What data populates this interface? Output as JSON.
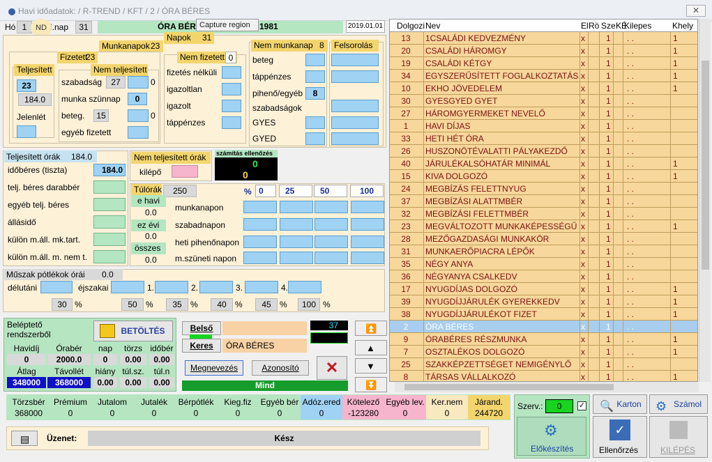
{
  "window": {
    "title": "Havi időadatok: / R-TREND / KFT / 2 / ÓRA BÉRES",
    "close": "✕"
  },
  "tooltip": "Capture region",
  "nd": "ND",
  "header": {
    "ho_label": "Hó",
    "ho_value": "1",
    "mnap_label": "i.nap",
    "mnap_value": "31",
    "title": "ÓRA BÉRE",
    "year_suffix": "1981",
    "date": "2019.01.01"
  },
  "munkanapok": {
    "label": "Munkanapok",
    "value": "23"
  },
  "napok": {
    "label": "Napok",
    "value": "31"
  },
  "fizetett": {
    "label": "Fizetett",
    "value": "23"
  },
  "teljesitett": {
    "label": "Teljesített",
    "value": "23",
    "sub": "184.0",
    "jelenlet": "Jelenlét"
  },
  "nem_teljesitett": {
    "label": "Nem teljesített",
    "rows": [
      {
        "label": "szabadság",
        "value": "27",
        "box": "0"
      },
      {
        "label": "munka szünnap",
        "box": "0"
      },
      {
        "label": "beteg.",
        "value": "15",
        "box": "0"
      },
      {
        "label": "egyéb fizetett"
      }
    ]
  },
  "nem_fizetett": {
    "label": "Nem fizetett",
    "value": "0",
    "rows": [
      "fizetés nélküli",
      "igazoltlan",
      "igazolt",
      "táppénzes"
    ]
  },
  "nem_munkanap": {
    "label": "Nem munkanap",
    "value": "8",
    "rows": [
      {
        "label": "beteg"
      },
      {
        "label": "táppénzes"
      },
      {
        "label": "pihenő/egyéb",
        "value": "8"
      },
      {
        "label": "szabadságok"
      },
      {
        "label": "GYES"
      },
      {
        "label": "GYED"
      }
    ]
  },
  "felsorolas": "Felsorolás",
  "teljesitett_orak": {
    "label": "Teljesített órák",
    "value": "184.0",
    "rows": [
      {
        "label": "időbéres (tiszta)",
        "value": "184.0"
      },
      {
        "label": "telj. béres darabbér"
      },
      {
        "label": "egyéb telj. béres"
      },
      {
        "label": "állásidő"
      },
      {
        "label": "külön m.áll. mk.tart."
      },
      {
        "label": "külön m.áll. m. nem t."
      }
    ]
  },
  "nem_telj_orak": {
    "label": "Nem teljesített órák",
    "kilepo": "kilépő"
  },
  "szamitas": {
    "label": "számítás ellenőzés",
    "v1": "0",
    "v2": "0"
  },
  "tulorak": {
    "label": "Túlórák",
    "value": "250",
    "e_havi": "e havi",
    "e_havi_v": "0.0",
    "ez_evi": "ez évi",
    "ez_evi_v": "0.0",
    "osszes": "összes",
    "osszes_v": "0.0",
    "pct": "%",
    "cols": [
      "0",
      "25",
      "50",
      "100"
    ],
    "rows": [
      "munkanapon",
      "szabadnapon",
      "heti pihenőnapon",
      "m.szüneti napon"
    ]
  },
  "muszak": {
    "label": "Műszak pótlékok órái",
    "value": "0.0",
    "delutani": "délutáni",
    "ejszakai": "éjszakai",
    "n1": "1.",
    "n2": "2.",
    "n3": "3.",
    "n4": "4.",
    "pcts": [
      "30",
      "50",
      "35",
      "40",
      "45",
      "100"
    ],
    "pct": "%"
  },
  "belepteto": {
    "label": "Beléptető rendszerből",
    "button": "BETÖLTÉS",
    "h1": [
      "Havidíj",
      "Órabér",
      "nap",
      "törzs",
      "időbér"
    ],
    "v1": [
      "0",
      "2000.0",
      "0",
      "0.00",
      "0.00"
    ],
    "h2": [
      "Átlag",
      "Távollét",
      "hiány",
      "túl.sz.",
      "túl.n"
    ],
    "v2": [
      "348000",
      "368000",
      "0.00",
      "0.00",
      "0.00"
    ]
  },
  "search": {
    "belso": "Belső",
    "keres": "Keres",
    "keres_value": "ÓRA BÉRES",
    "num": "37",
    "megnevezes": "Megnevezés",
    "azonosito": "Azonosító",
    "mind": "Mind"
  },
  "grid": {
    "headers": [
      "Dolgozi",
      "Nev",
      "El",
      "Rö",
      "Sze",
      "KÉ",
      "Kilepes",
      "Khely"
    ],
    "rows": [
      [
        "13",
        "1CSALÁDI  KEDVEZMÉNY",
        "x",
        "1",
        "1"
      ],
      [
        "20",
        "CSALÁDI HÁROMGY",
        "x",
        "1",
        "1"
      ],
      [
        "19",
        "CSALÁDI KÉTGY",
        "x",
        "1",
        "1"
      ],
      [
        "34",
        "EGYSZERŰSÍTETT FOGLALKOZTATÁS",
        "x",
        "1",
        "1"
      ],
      [
        "10",
        "EKHO JÖVEDELEM",
        "x",
        "1",
        "1"
      ],
      [
        "30",
        "GYESGYED GYET",
        "x",
        "1",
        ""
      ],
      [
        "27",
        "HÁROMGYERMEKET NEVELŐ",
        "x",
        "1",
        ""
      ],
      [
        "1",
        "HAVI DÍJAS",
        "x",
        "1",
        ""
      ],
      [
        "33",
        "HETI HÉT ÓRA",
        "x",
        "1",
        ""
      ],
      [
        "26",
        "HUSZONÖTÉVALATTI  PÁLYAKEZDŐ",
        "x",
        "1",
        ""
      ],
      [
        "40",
        "JÁRULÉKALSÓHATÁR  MINIMÁL",
        "x",
        "1",
        "1"
      ],
      [
        "15",
        "KIVA DOLGOZÓ",
        "x",
        "1",
        "1"
      ],
      [
        "24",
        "MEGBÍZÁS FELETTNYUG",
        "x",
        "1",
        ""
      ],
      [
        "37",
        "MEGBÍZÁSI ALATTMBÉR",
        "x",
        "1",
        ""
      ],
      [
        "32",
        "MEGBÍZÁSI FELETTMBÉR",
        "x",
        "1",
        ""
      ],
      [
        "23",
        "MEGVÁLTOZOTT MUNKAKÉPESSÉGŰ",
        "x",
        "1",
        "1"
      ],
      [
        "28",
        "MEZŐGAZDASÁGI MUNKAKÖR",
        "x",
        "1",
        ""
      ],
      [
        "31",
        "MUNKAERŐPIACRA LÉPŐK",
        "x",
        "1",
        ""
      ],
      [
        "35",
        "NÉGY ANYA",
        "x",
        "1",
        ""
      ],
      [
        "36",
        "NÉGYANYA CSALKEDV",
        "x",
        "1",
        ""
      ],
      [
        "17",
        "NYUGDÍJAS DOLGOZÓ",
        "x",
        "1",
        "1"
      ],
      [
        "39",
        "NYUGDÍJJÁRULÉK GYEREKKEDV",
        "x",
        "1",
        "1"
      ],
      [
        "38",
        "NYUGDÍJJÁRULÉKOT FIZET",
        "x",
        "1",
        "1"
      ],
      [
        "2",
        "ÓRA BÉRES",
        "x",
        "1",
        ""
      ],
      [
        "9",
        "ÓRABÉRES RÉSZMUNKA",
        "x",
        "1",
        "1"
      ],
      [
        "7",
        "OSZTALÉKOS DOLGOZÓ",
        "x",
        "1",
        "1"
      ],
      [
        "25",
        "SZAKKÉPZETTSÉGET NEMIGÉNYLŐ",
        "x",
        "1",
        ""
      ],
      [
        "8",
        "TÁRSAS VÁLLALKOZÓ",
        "x",
        "1",
        "1"
      ]
    ],
    "dots": ". ."
  },
  "totals": {
    "headers": [
      "Törzsbér",
      "Prémium",
      "Jutalom",
      "Jutalék",
      "Bérpótlék",
      "Kieg.fiz",
      "Egyéb bér",
      "Adóz.ered",
      "Kötelező",
      "Egyéb lev.",
      "Ker.nem",
      "Járand."
    ],
    "values": [
      "368000",
      "0",
      "0",
      "0",
      "0",
      "0",
      "0",
      "0",
      "-123280",
      "0",
      "0",
      "244720"
    ]
  },
  "uzenet": {
    "label": "Üzenet:",
    "value": "Kész"
  },
  "right": {
    "szerv": "Szerv.:",
    "szerv_value": "0",
    "karton": "Karton",
    "szamol": "Számol",
    "elokeszites": "Előkészítés",
    "ellenorzes": "Ellenőrzés",
    "kilepes": "KILÉPÉS"
  }
}
